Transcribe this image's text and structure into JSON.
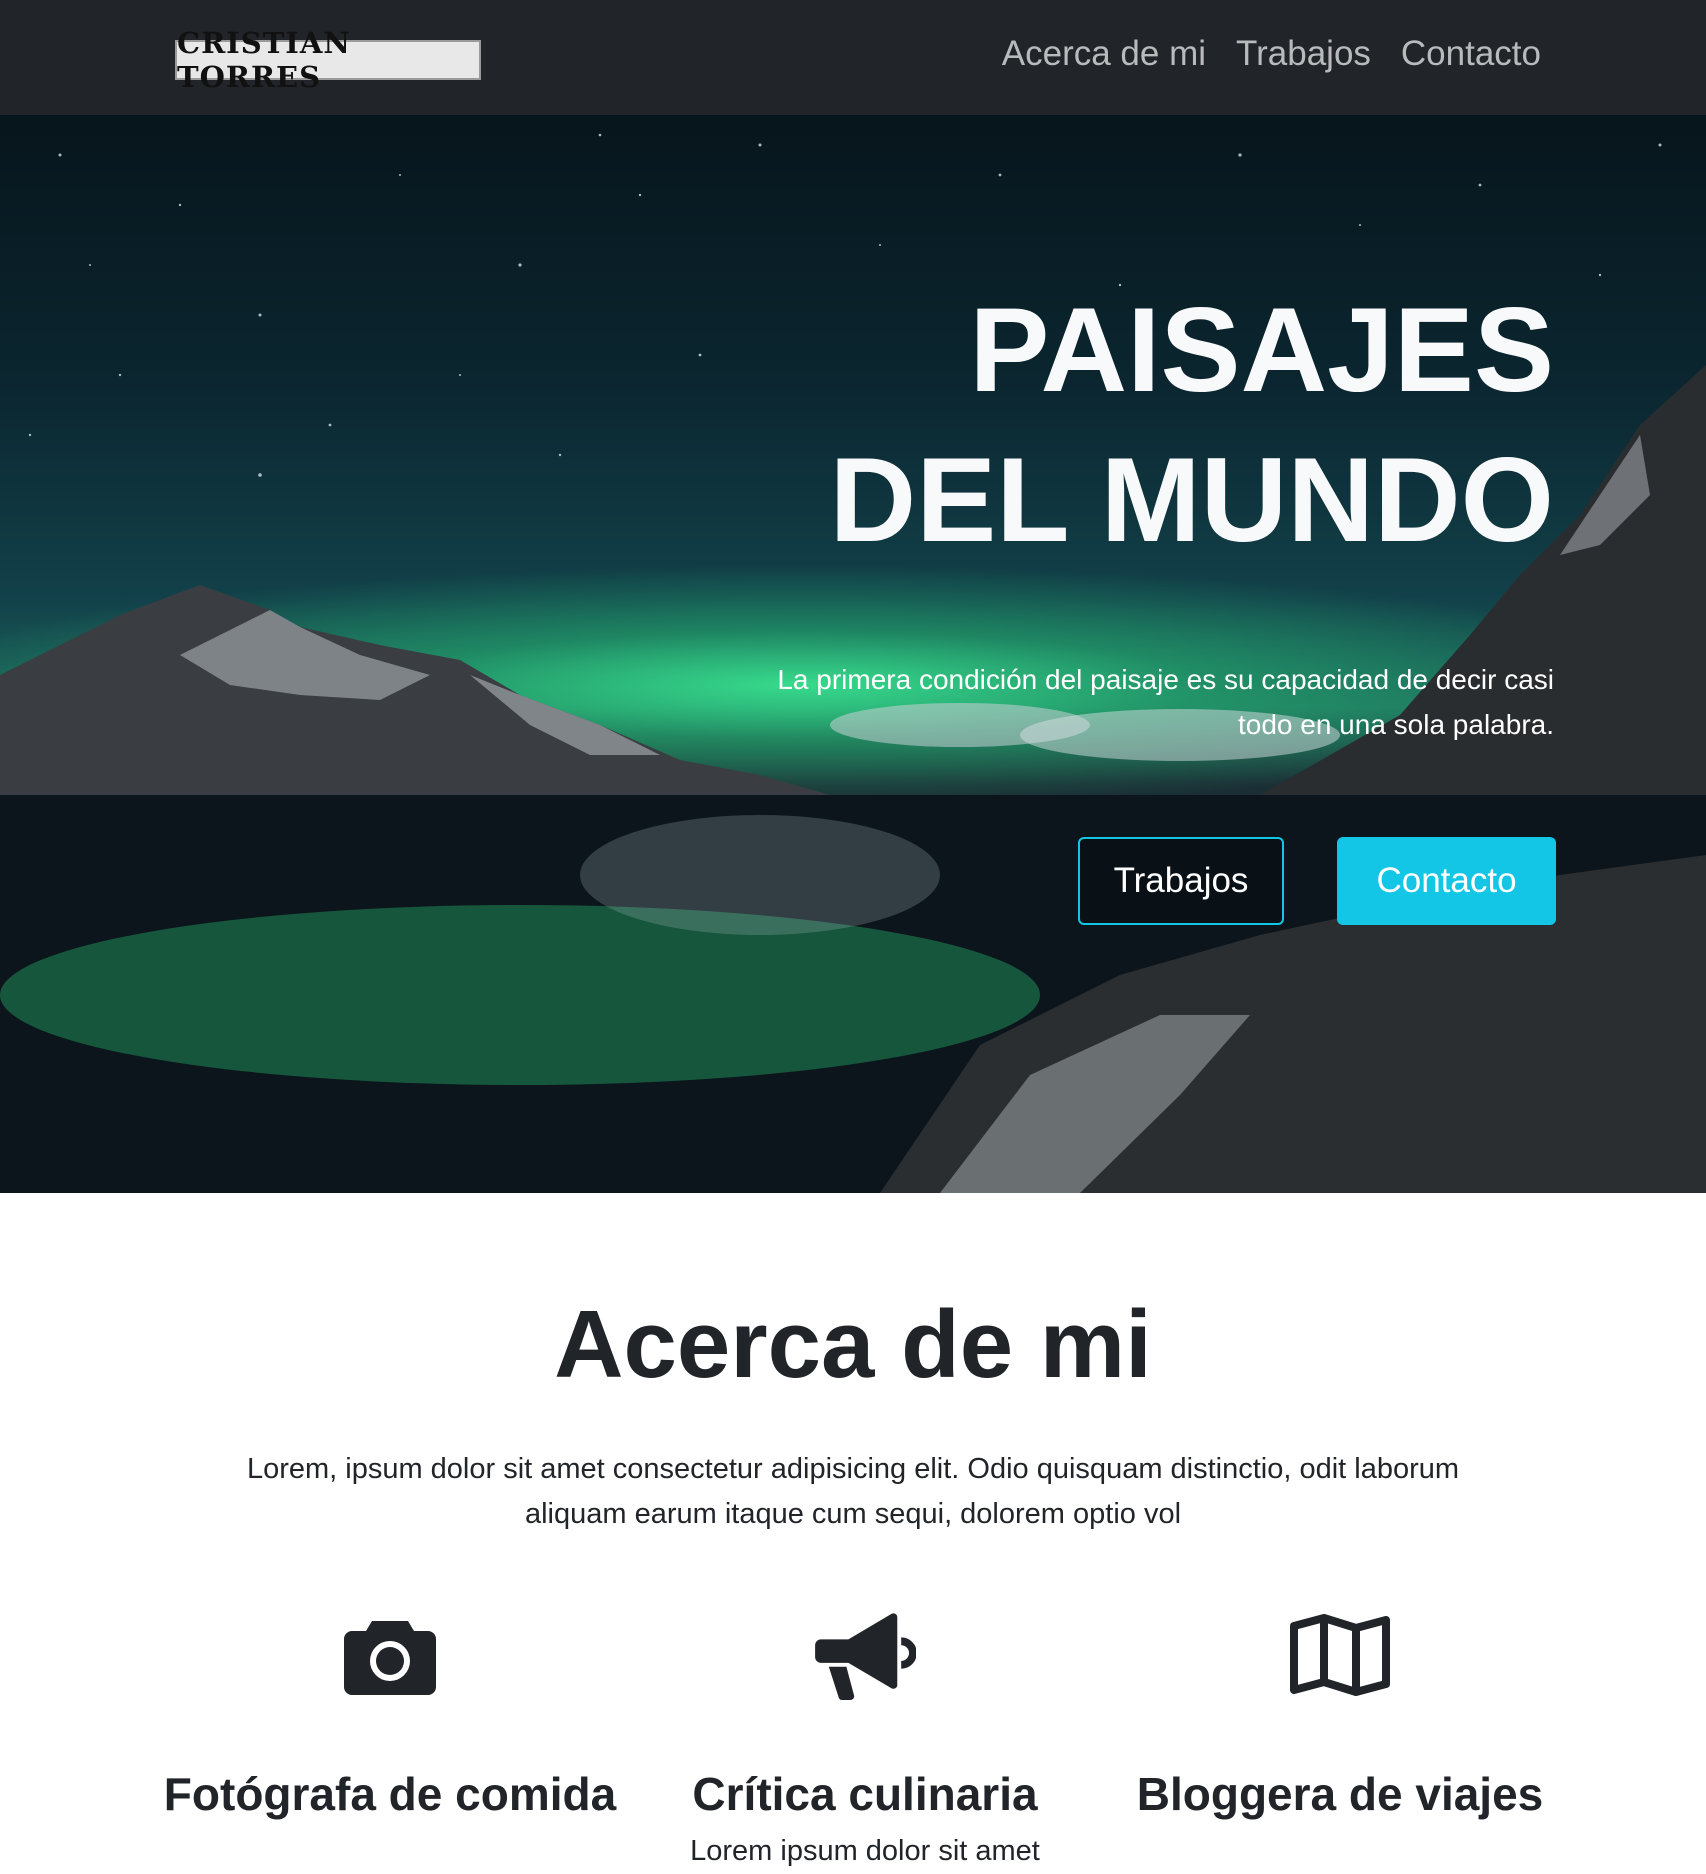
{
  "navbar": {
    "brand": "CRISTIAN TORRES",
    "links": [
      "Acerca de mi",
      "Trabajos",
      "Contacto"
    ]
  },
  "hero": {
    "title_line1": "PAISAJES",
    "title_line2": "DEL MUNDO",
    "subtitle": "La primera condición del paisaje es su capacidad de decir casi todo en una sola palabra.",
    "button_outline": "Trabajos",
    "button_primary": "Contacto"
  },
  "about": {
    "title": "Acerca de mi",
    "text": "Lorem, ipsum dolor sit amet consectetur adipisicing elit. Odio quisquam distinctio, odit laborum aliquam earum itaque cum sequi, dolorem optio vol",
    "features": [
      {
        "icon": "camera-icon",
        "title": "Fotógrafa de comida",
        "text": ""
      },
      {
        "icon": "megaphone-icon",
        "title": "Crítica culinaria",
        "text": "Lorem ipsum dolor sit amet"
      },
      {
        "icon": "map-icon",
        "title": "Bloggera de viajes",
        "text": ""
      }
    ]
  },
  "colors": {
    "navbar_bg": "#212529",
    "accent": "#13c6e6",
    "text_dark": "#212529"
  }
}
